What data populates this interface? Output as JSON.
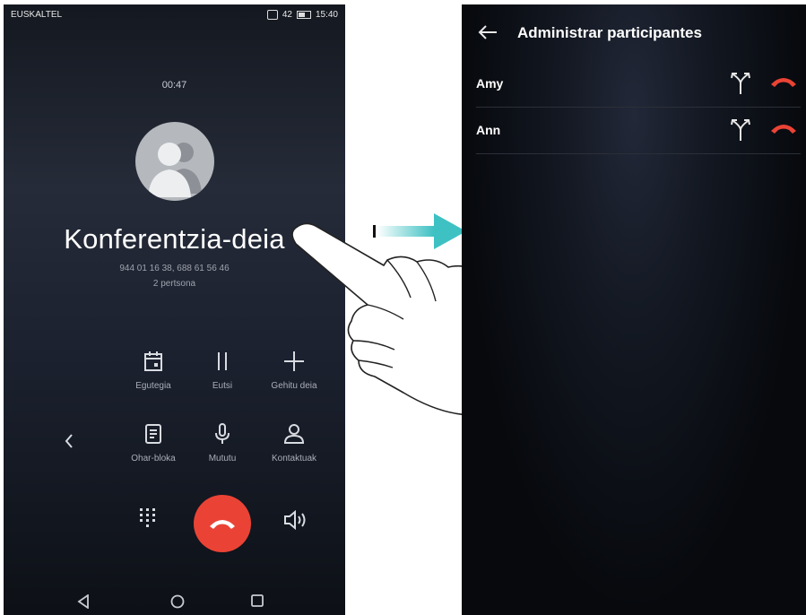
{
  "left_phone": {
    "status": {
      "carrier": "EUSKALTEL",
      "indicators": "42",
      "time": "15:40"
    },
    "call": {
      "timer": "00:47",
      "title": "Konferentzia-deia",
      "numbers": "944 01 16 38, 688 61 56 46",
      "participants_count": "2 pertsona"
    },
    "actions": [
      {
        "label": "Egutegia",
        "icon": "calendar-icon"
      },
      {
        "label": "Eutsi",
        "icon": "pause-icon"
      },
      {
        "label": "Gehitu deia",
        "icon": "plus-icon"
      },
      {
        "label": "Ohar-bloka",
        "icon": "notepad-icon"
      },
      {
        "label": "Mututu",
        "icon": "microphone-icon"
      },
      {
        "label": "Kontaktuak",
        "icon": "contact-icon"
      }
    ],
    "bottom": {
      "keypad_icon": "dialpad-icon",
      "end_icon": "end-call-icon",
      "speaker_icon": "speaker-icon"
    },
    "colors": {
      "end_call": "#ea4335"
    }
  },
  "right_phone": {
    "title": "Administrar participantes",
    "participants": [
      {
        "name": "Amy"
      },
      {
        "name": "Ann"
      }
    ],
    "colors": {
      "hangup": "#ea4335",
      "accent_arrow": "#3ec1c3"
    }
  }
}
